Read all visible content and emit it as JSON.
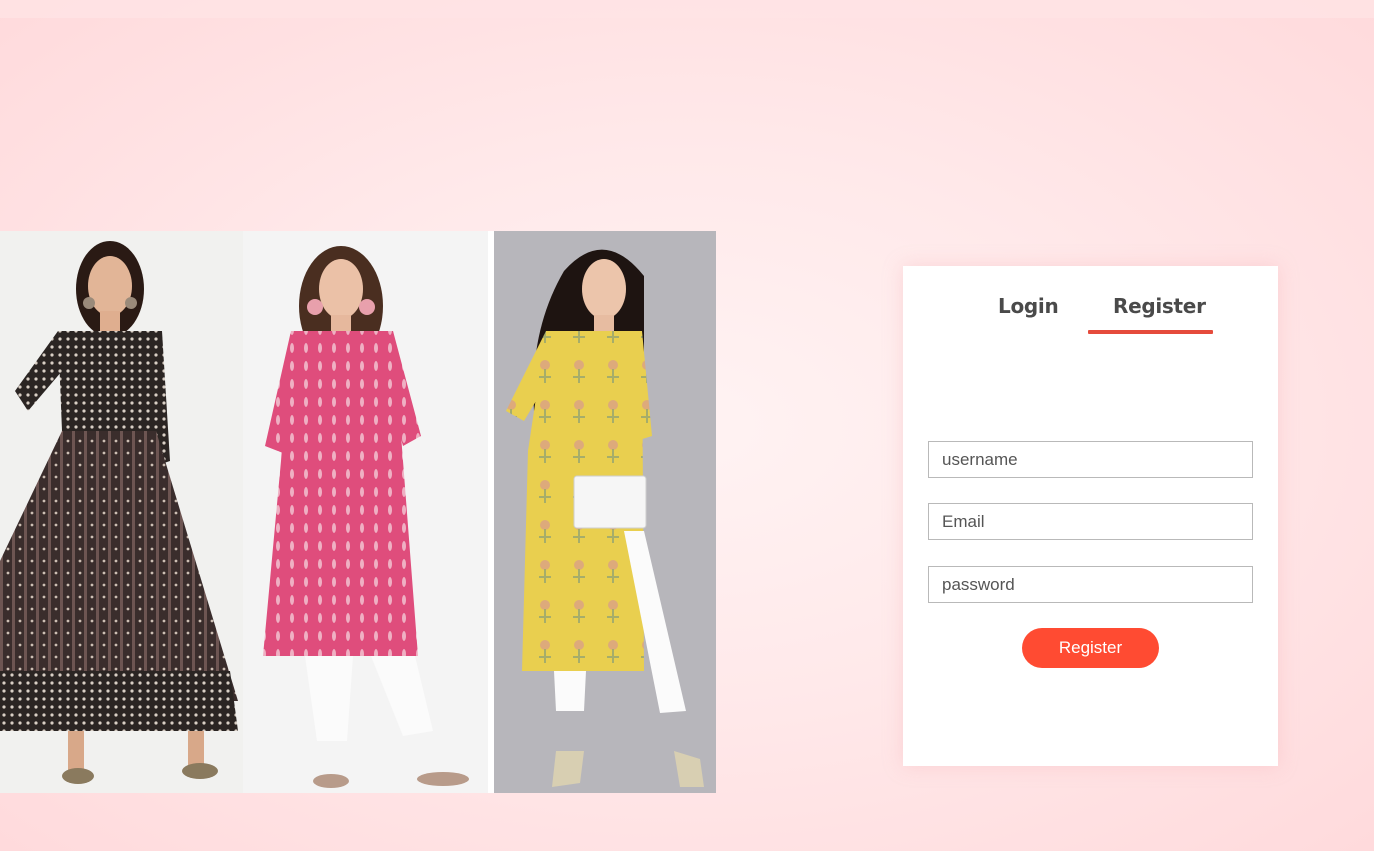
{
  "gallery": {
    "items": [
      {
        "name": "black-printed-anarkali-kurta",
        "dress_color": "#2b2523",
        "pattern_color": "#d9cfc5"
      },
      {
        "name": "pink-printed-straight-kurta",
        "dress_color": "#df4d7c",
        "pattern_color": "#f2c9d4"
      },
      {
        "name": "yellow-floral-straight-kurta",
        "dress_color": "#e9cf4f",
        "pattern_color": "#b9b46a"
      }
    ]
  },
  "auth": {
    "tabs": [
      {
        "label": "Login",
        "active": false
      },
      {
        "label": "Register",
        "active": true
      }
    ],
    "fields": {
      "username": {
        "placeholder": "username",
        "value": ""
      },
      "email": {
        "placeholder": "Email",
        "value": ""
      },
      "password": {
        "placeholder": "password",
        "value": ""
      }
    },
    "submit_label": "Register"
  },
  "colors": {
    "accent": "#ff4b32",
    "tab_underline": "#e54b3c",
    "background": "#ffe9ea"
  }
}
